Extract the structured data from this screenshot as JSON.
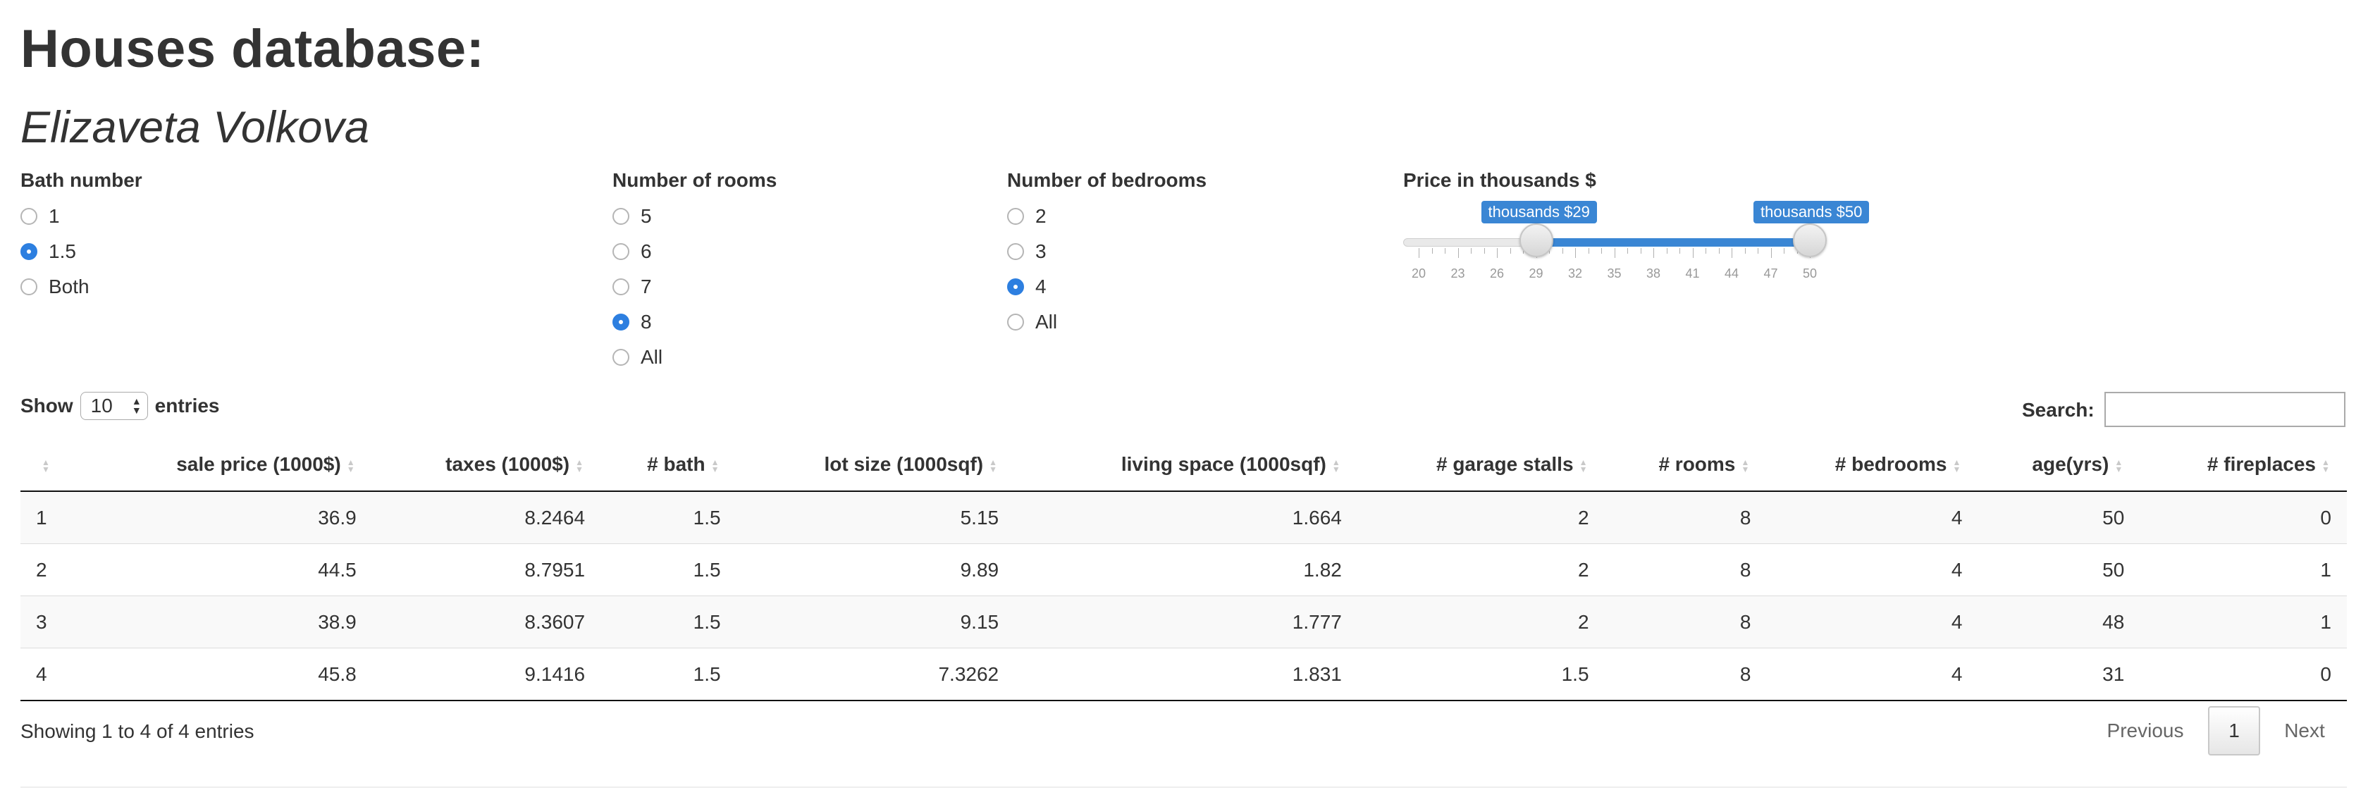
{
  "header": {
    "title": "Houses database:",
    "subtitle": "Elizaveta Volkova"
  },
  "filters": {
    "bath": {
      "label": "Bath number",
      "options": [
        {
          "label": "1",
          "checked": false
        },
        {
          "label": "1.5",
          "checked": true
        },
        {
          "label": "Both",
          "checked": false
        }
      ]
    },
    "rooms": {
      "label": "Number of rooms",
      "options": [
        {
          "label": "5",
          "checked": false
        },
        {
          "label": "6",
          "checked": false
        },
        {
          "label": "7",
          "checked": false
        },
        {
          "label": "8",
          "checked": true
        },
        {
          "label": "All",
          "checked": false
        }
      ]
    },
    "bedrooms": {
      "label": "Number of bedrooms",
      "options": [
        {
          "label": "2",
          "checked": false
        },
        {
          "label": "3",
          "checked": false
        },
        {
          "label": "4",
          "checked": true
        },
        {
          "label": "All",
          "checked": false
        }
      ]
    },
    "price": {
      "label": "Price in thousands $",
      "min": 20,
      "max": 50,
      "low_value": 29,
      "high_value": 50,
      "low_label": "thousands $29",
      "high_label": "thousands $50",
      "ticks": [
        "20",
        "23",
        "26",
        "29",
        "32",
        "35",
        "38",
        "41",
        "44",
        "47",
        "50"
      ],
      "accent_color": "#3a86d4"
    }
  },
  "table_controls": {
    "show_label": "Show",
    "entries_value": "10",
    "entries_label": "entries",
    "search_label": "Search:",
    "search_value": ""
  },
  "table": {
    "columns": [
      "",
      "sale price (1000$)",
      "taxes (1000$)",
      "# bath",
      "lot size (1000sqf)",
      "living space (1000sqf)",
      "# garage stalls",
      "# rooms",
      "# bedrooms",
      "age(yrs)",
      "# fireplaces"
    ],
    "rows": [
      [
        "1",
        "36.9",
        "8.2464",
        "1.5",
        "5.15",
        "1.664",
        "2",
        "8",
        "4",
        "50",
        "0"
      ],
      [
        "2",
        "44.5",
        "8.7951",
        "1.5",
        "9.89",
        "1.82",
        "2",
        "8",
        "4",
        "50",
        "1"
      ],
      [
        "3",
        "38.9",
        "8.3607",
        "1.5",
        "9.15",
        "1.777",
        "2",
        "8",
        "4",
        "48",
        "1"
      ],
      [
        "4",
        "45.8",
        "9.1416",
        "1.5",
        "7.3262",
        "1.831",
        "1.5",
        "8",
        "4",
        "31",
        "0"
      ]
    ]
  },
  "footer": {
    "info": "Showing 1 to 4 of 4 entries",
    "previous": "Previous",
    "current_page": "1",
    "next": "Next"
  }
}
